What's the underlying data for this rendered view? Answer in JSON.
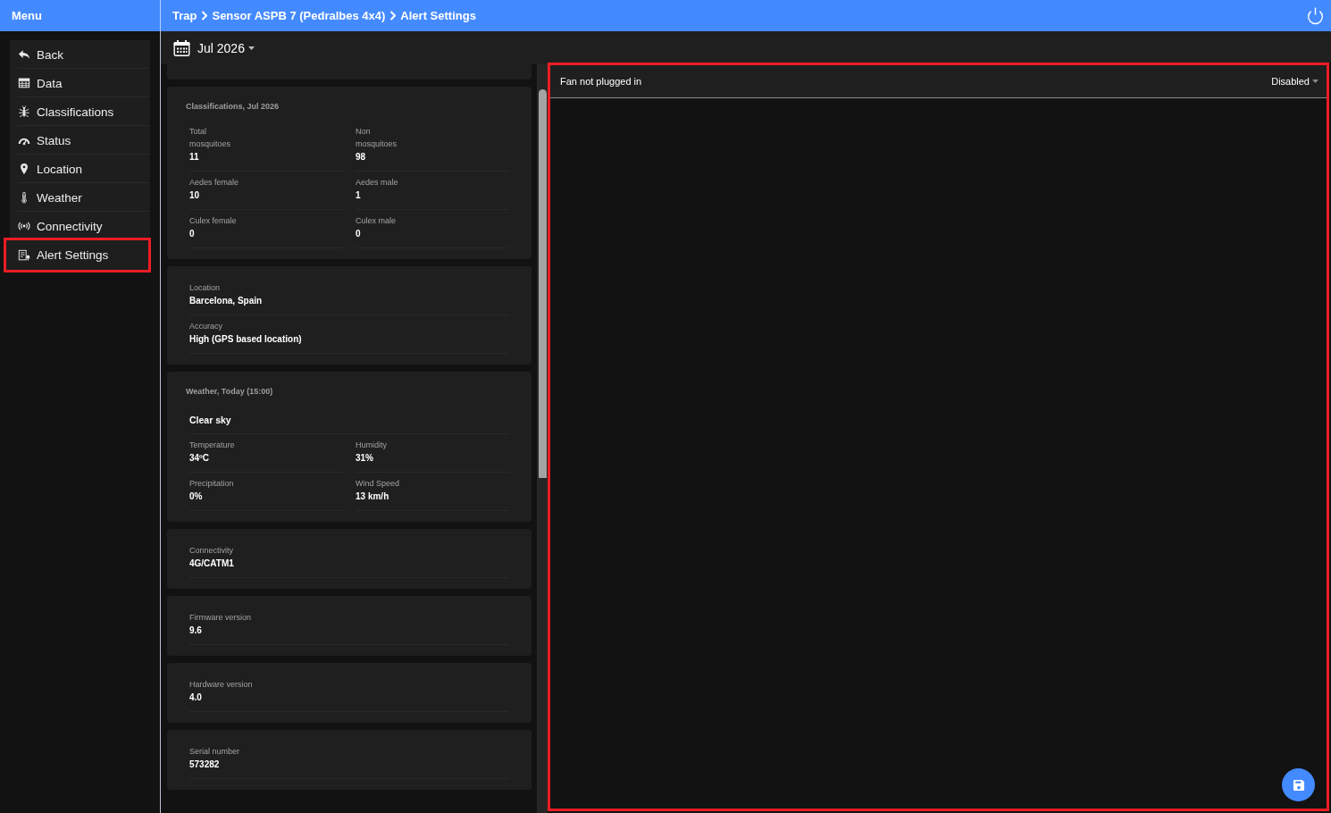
{
  "top_bar": {
    "menu_title": "Menu",
    "breadcrumb": [
      "Trap",
      "Sensor ASPB 7 (Pedralbes 4x4)",
      "Alert Settings"
    ]
  },
  "sidebar": {
    "items": [
      {
        "label": "Back",
        "selected": false
      },
      {
        "label": "Data",
        "selected": false
      },
      {
        "label": "Classifications",
        "selected": false
      },
      {
        "label": "Status",
        "selected": false
      },
      {
        "label": "Location",
        "selected": false
      },
      {
        "label": "Weather",
        "selected": false
      },
      {
        "label": "Connectivity",
        "selected": false
      },
      {
        "label": "Alert Settings",
        "selected": true
      }
    ]
  },
  "date_picker": {
    "value": "Jul 2026"
  },
  "cards": [
    {
      "kind": "grid",
      "title": "Classifications, Jul 2026",
      "fields": [
        {
          "label": "Total\nmosquitoes",
          "value": "11"
        },
        {
          "label": "Non\nmosquitoes",
          "value": "98"
        },
        {
          "label": "Aedes female",
          "value": "10"
        },
        {
          "label": "Aedes male",
          "value": "1"
        },
        {
          "label": "Culex female",
          "value": "0"
        },
        {
          "label": "Culex male",
          "value": "0"
        }
      ]
    },
    {
      "kind": "list",
      "fields": [
        {
          "label": "Location",
          "value": "Barcelona, Spain"
        },
        {
          "label": "Accuracy",
          "value": "High (GPS based location)"
        }
      ]
    },
    {
      "kind": "grid",
      "title": "Weather, Today (15:00)",
      "headline": "Clear sky",
      "fields": [
        {
          "label": "Temperature",
          "value": "34ºC"
        },
        {
          "label": "Humidity",
          "value": "31%"
        },
        {
          "label": "Precipitation",
          "value": "0%"
        },
        {
          "label": "Wind Speed",
          "value": "13 km/h"
        }
      ]
    },
    {
      "kind": "list",
      "fields": [
        {
          "label": "Connectivity",
          "value": "4G/CATM1"
        }
      ]
    },
    {
      "kind": "list",
      "fields": [
        {
          "label": "Firmware version",
          "value": "9.6"
        }
      ]
    },
    {
      "kind": "list",
      "fields": [
        {
          "label": "Hardware version",
          "value": "4.0"
        }
      ]
    },
    {
      "kind": "list",
      "fields": [
        {
          "label": "Serial number",
          "value": "573282"
        }
      ]
    }
  ],
  "alert_panel": {
    "highlighted": true,
    "alerts": [
      {
        "label": "Fan not plugged in",
        "value": "Disabled"
      }
    ]
  }
}
